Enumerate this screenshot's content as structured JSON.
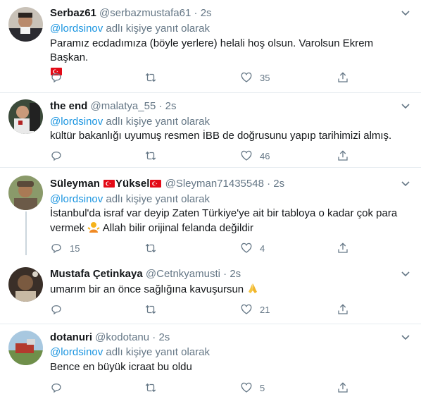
{
  "colors": {
    "link": "#1b95e0",
    "muted": "#657786",
    "text": "#14171a",
    "divider": "#e6ecf0"
  },
  "tweets": [
    {
      "name": "Serbaz61",
      "handle": "@serbazmustafa61",
      "dot": "·",
      "time": "2s",
      "reply_mention": "@lordsinov",
      "reply_suffix": " adlı kişiye yanıt olarak",
      "text": "Paramız ecdadımıza (böyle yerlere) helali hoş olsun. Varolsun Ekrem Başkan.",
      "text_emoji": "turkish-flag",
      "reply_count": "",
      "retweet_count": "",
      "like_count": "35"
    },
    {
      "name": "the end",
      "handle": "@malatya_55",
      "dot": "·",
      "time": "2s",
      "reply_mention": "@lordsinov",
      "reply_suffix": " adlı kişiye yanıt olarak",
      "text": "kültür bakanlığı uyumuş resmen İBB de doğrusunu yapıp tarihimizi almış.",
      "reply_count": "",
      "retweet_count": "",
      "like_count": "46"
    },
    {
      "name_part1": "Süleyman",
      "name_part2": "Yüksel",
      "handle": "@Sleyman71435548",
      "dot": "·",
      "time": "2s",
      "reply_mention": "@lordsinov",
      "reply_suffix": " adlı kişiye yanıt olarak",
      "text_line1": "İstanbul'da israf var deyip Zaten Türkiye'ye ait bir tabloya o kadar çok para",
      "text_line2_a": "vermek",
      "text_line2_b": "Allah bilir orijinal felanda değildir",
      "text_emoji": "person-shrugging",
      "reply_count": "15",
      "retweet_count": "",
      "like_count": "4"
    },
    {
      "name": "Mustafa Çetinkaya",
      "handle": "@Cetnkyamusti",
      "dot": "·",
      "time": "2s",
      "text": "umarım bir an önce sağlığına kavuşursun",
      "text_emoji": "folded-hands",
      "reply_count": "",
      "retweet_count": "",
      "like_count": "21"
    },
    {
      "name": "dotanuri",
      "handle": "@kodotanu",
      "dot": "·",
      "time": "2s",
      "reply_mention": "@lordsinov",
      "reply_suffix": " adlı kişiye yanıt olarak",
      "text": "Bence en büyük icraat bu oldu",
      "reply_count": "",
      "retweet_count": "",
      "like_count": "5"
    }
  ]
}
